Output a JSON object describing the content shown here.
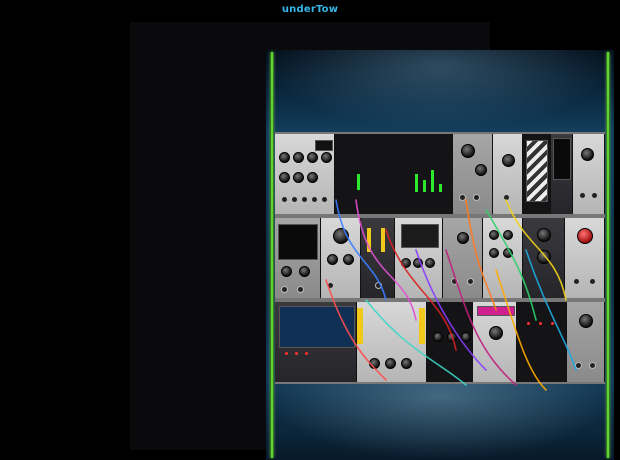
{
  "window": {
    "title": "underTow"
  },
  "rack": {
    "rows": [
      "row-1",
      "row-2",
      "row-3"
    ],
    "accent_color": "#58d82a",
    "title_color": "#37b6e8"
  }
}
